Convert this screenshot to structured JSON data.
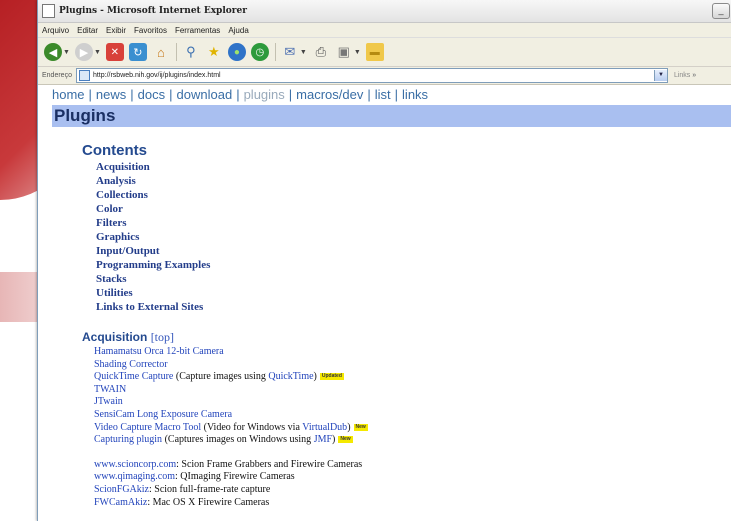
{
  "window": {
    "title": "Plugins - Microsoft Internet Explorer",
    "minimize_glyph": "_"
  },
  "menu": [
    "Arquivo",
    "Editar",
    "Exibir",
    "Favoritos",
    "Ferramentas",
    "Ajuda"
  ],
  "toolbar_icons": [
    "back-icon",
    "forward-icon",
    "stop-icon",
    "refresh-icon",
    "home-icon",
    "search-icon",
    "favorites-icon",
    "media-icon",
    "history-icon",
    "mail-icon",
    "print-icon",
    "edit-icon",
    "folder-icon"
  ],
  "address": {
    "label": "Endereço",
    "url": "http://rsbweb.nih.gov/ij/plugins/index.html",
    "links_label": "Links",
    "chevron": "»"
  },
  "nav": {
    "items": [
      "home",
      "news",
      "docs",
      "download",
      "plugins",
      "macros/dev",
      "list",
      "links"
    ],
    "separator": "|",
    "current": "plugins"
  },
  "page": {
    "title": "Plugins",
    "contents_heading": "Contents",
    "contents": [
      "Acquisition",
      "Analysis",
      "Collections",
      "Color",
      "Filters",
      "Graphics",
      "Input/Output",
      "Programming Examples",
      "Stacks",
      "Utilities",
      "Links to External Sites"
    ],
    "acquisition_heading": "Acquisition",
    "top_link": "[top]",
    "acquisition_items": [
      {
        "link": "Hamamatsu Orca 12-bit Camera"
      },
      {
        "link": "Shading Corrector"
      },
      {
        "link": "QuickTime Capture",
        "pre": " (Capture images using ",
        "link2": "QuickTime",
        "post": ")",
        "badge": "Updated"
      },
      {
        "link": "TWAIN"
      },
      {
        "link": "JTwain"
      },
      {
        "link": "SensiCam Long Exposure Camera"
      },
      {
        "link": "Video Capture Macro Tool",
        "pre": " (Video for Windows via ",
        "link2": "VirtualDub",
        "post": ")",
        "badge": "New"
      },
      {
        "link": "Capturing plugin",
        "pre": " (Captures images on Windows using ",
        "link2": "JMF",
        "post": ")",
        "badge": "New"
      }
    ],
    "external_items": [
      {
        "link": "www.scioncorp.com",
        "text": ": Scion Frame Grabbers and Firewire Cameras"
      },
      {
        "link": "www.qimaging.com",
        "text": ": QImaging Firewire Cameras"
      },
      {
        "link": "ScionFGAkiz",
        "text": ": Scion full-frame-rate capture"
      },
      {
        "link": "FWCamAkiz",
        "text": ": Mac OS X Firewire Cameras"
      }
    ]
  },
  "colors": {
    "accent_bar": "#a9bff0",
    "link": "#2244bb",
    "badge": "#f5e900",
    "slide_red": "#b62024"
  }
}
